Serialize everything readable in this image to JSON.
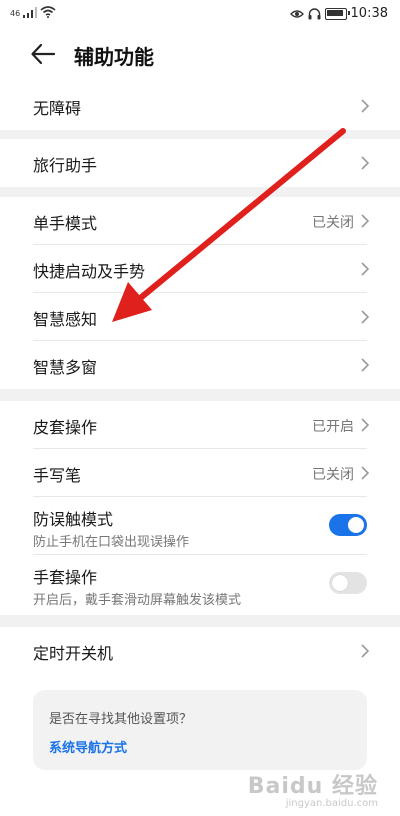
{
  "status_bar": {
    "time": "10:38",
    "signal_text": "46"
  },
  "header": {
    "title": "辅助功能"
  },
  "groups": {
    "g1": [
      {
        "label": "无障碍"
      }
    ],
    "g2": [
      {
        "label": "旅行助手"
      }
    ],
    "g3": [
      {
        "label": "单手模式",
        "value": "已关闭"
      },
      {
        "label": "快捷启动及手势"
      },
      {
        "label": "智慧感知"
      },
      {
        "label": "智慧多窗"
      }
    ],
    "g4": [
      {
        "label": "皮套操作",
        "value": "已开启"
      },
      {
        "label": "手写笔",
        "value": "已关闭"
      },
      {
        "label": "防误触模式",
        "sub": "防止手机在口袋出现误操作",
        "toggle": true
      },
      {
        "label": "手套操作",
        "sub": "开启后，戴手套滑动屏幕触发该模式",
        "toggle": false
      }
    ],
    "g5": [
      {
        "label": "定时开关机"
      }
    ]
  },
  "suggestion_card": {
    "question": "是否在寻找其他设置项？",
    "link": "系统导航方式"
  },
  "annotation": {
    "arrow_color": "#e0201c"
  },
  "watermark": {
    "main": "Baidu 经验",
    "sub": "jingyan.baidu.com"
  },
  "colors": {
    "accent": "#1a73e8",
    "toggle_off": "#e3e3e3",
    "section_gap": "#f1f1f1"
  }
}
